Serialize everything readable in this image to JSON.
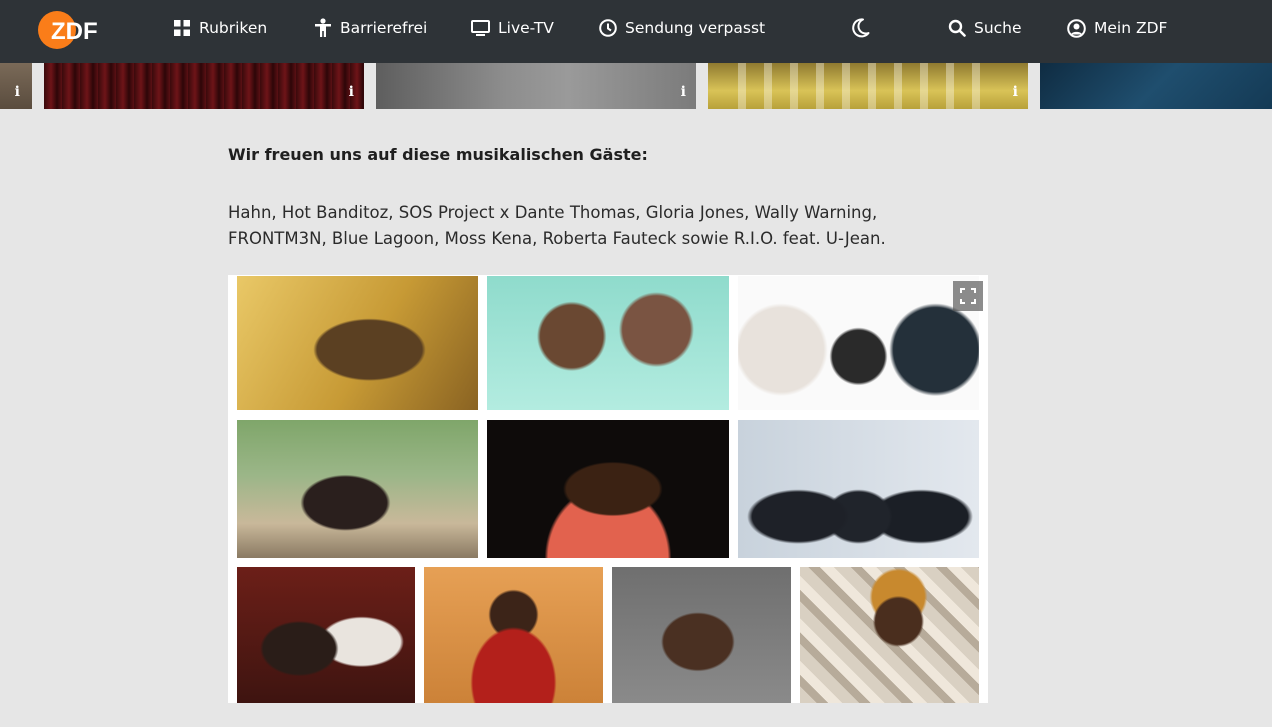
{
  "brand": {
    "logo_text": "ZDF",
    "accent": "#fa7d19"
  },
  "nav": {
    "rubriken": "Rubriken",
    "barrierefrei": "Barrierefrei",
    "livetv": "Live-TV",
    "sendung_verpasst": "Sendung verpasst",
    "suche": "Suche",
    "mein_zdf": "Mein ZDF",
    "icons": [
      "grid-icon",
      "accessibility-icon",
      "tv-icon",
      "clock-icon",
      "moon-icon",
      "search-icon",
      "user-icon"
    ]
  },
  "teasers": {
    "info_label": "i"
  },
  "article": {
    "heading": "Wir freuen uns auf diese musikalischen Gäste:",
    "guests_line1": "Hahn, Hot Banditoz, SOS Project x Dante Thomas, Gloria Jones, Wally Warning,",
    "guests_line2": "FRONTM3N, Blue Lagoon, Moss Kena, Roberta Fauteck sowie R.I.O. feat. U-Jean."
  },
  "gallery": {
    "photo_count": 10,
    "fullscreen_icon": "expand-icon"
  }
}
